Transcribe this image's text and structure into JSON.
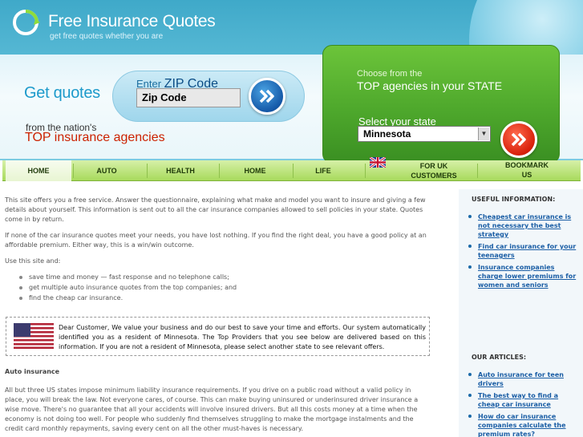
{
  "header": {
    "logo_title": "Free Insurance Quotes",
    "logo_subtitle": "get free quotes whether you are",
    "get_quotes": "Get quotes",
    "from_nations": "from the nation's",
    "top_insurance": "TOP insurance agencies",
    "zip_label_prefix": "Enter",
    "zip_label_main": "ZIP Code",
    "zip_value": "Zip Code",
    "choose_from": "Choose from the",
    "top_agencies_state_a": "TOP agencies",
    "top_agencies_state_b": "in your STATE",
    "select_state_label": "Select your state",
    "state_value": "Minnesota"
  },
  "nav": {
    "items": [
      {
        "label": "HOME"
      },
      {
        "label": "AUTO"
      },
      {
        "label": "HEALTH"
      },
      {
        "label": "HOME"
      },
      {
        "label": "LIFE"
      },
      {
        "label": "FOR UK CUSTOMERS"
      },
      {
        "label": "BOOKMARK US"
      }
    ]
  },
  "main": {
    "intro": "This site offers you a free service. Answer the questionnaire, explaining what make and model you want to insure and giving a few details about yourself. This information is sent out to all the car insurance companies allowed to sell policies in your state. Quotes come in by return.",
    "p2": "If none of the car insurance quotes meet your needs, you have lost nothing. If you find the right deal, you have a good policy at an affordable premium. Either way, this is a win/win outcome.",
    "use_label": "Use this site and:",
    "bullets": [
      "save time and money — fast response and no telephone calls;",
      "get multiple auto insurance quotes from the top companies; and",
      "find the cheap car insurance."
    ],
    "notice": "Dear Customer, We value your business and do our best to save your time and efforts. Our system automatically identified you as a resident of Minnesota. The Top Providers that you see below are delivered based on this information. If you are not a resident of Minnesota, please select another state to see relevant offers.",
    "auto_heading": "Auto insurance",
    "auto_text": "All but three US states impose minimum liability insurance requirements. If you drive on a public road without a valid policy in place, you will break the law. Not everyone cares, of course. This can make buying uninsured or underinsured driver insurance a wise move. There's no guarantee that all your accidents will involve insured drivers. But all this costs money at a time when the economy is not doing too well. For people who suddenly find themselves struggling to make the mortgage instalments and the credit card monthly repayments, saving every cent on all the other must-haves is necessary."
  },
  "sidebar": {
    "useful_heading": "USEFUL INFORMATION:",
    "useful_links": [
      "Cheapest car insurance is not necessary the best strategy",
      "Find car insurance for your teenagers",
      "Insurance companies charge lower premiums for women and seniors"
    ],
    "articles_heading": "OUR ARTICLES:",
    "article_links": [
      "Auto insurance for teen drivers",
      "The best way to find a cheap car insurance",
      "How do car insurance companies calculate the premium rates?"
    ]
  },
  "colors": {
    "header_blue": "#3fa9c9",
    "green_panel": "#4ea82c",
    "nav_green": "#a8da5c",
    "link_blue": "#1b5ea5",
    "accent_red": "#cc2200"
  }
}
